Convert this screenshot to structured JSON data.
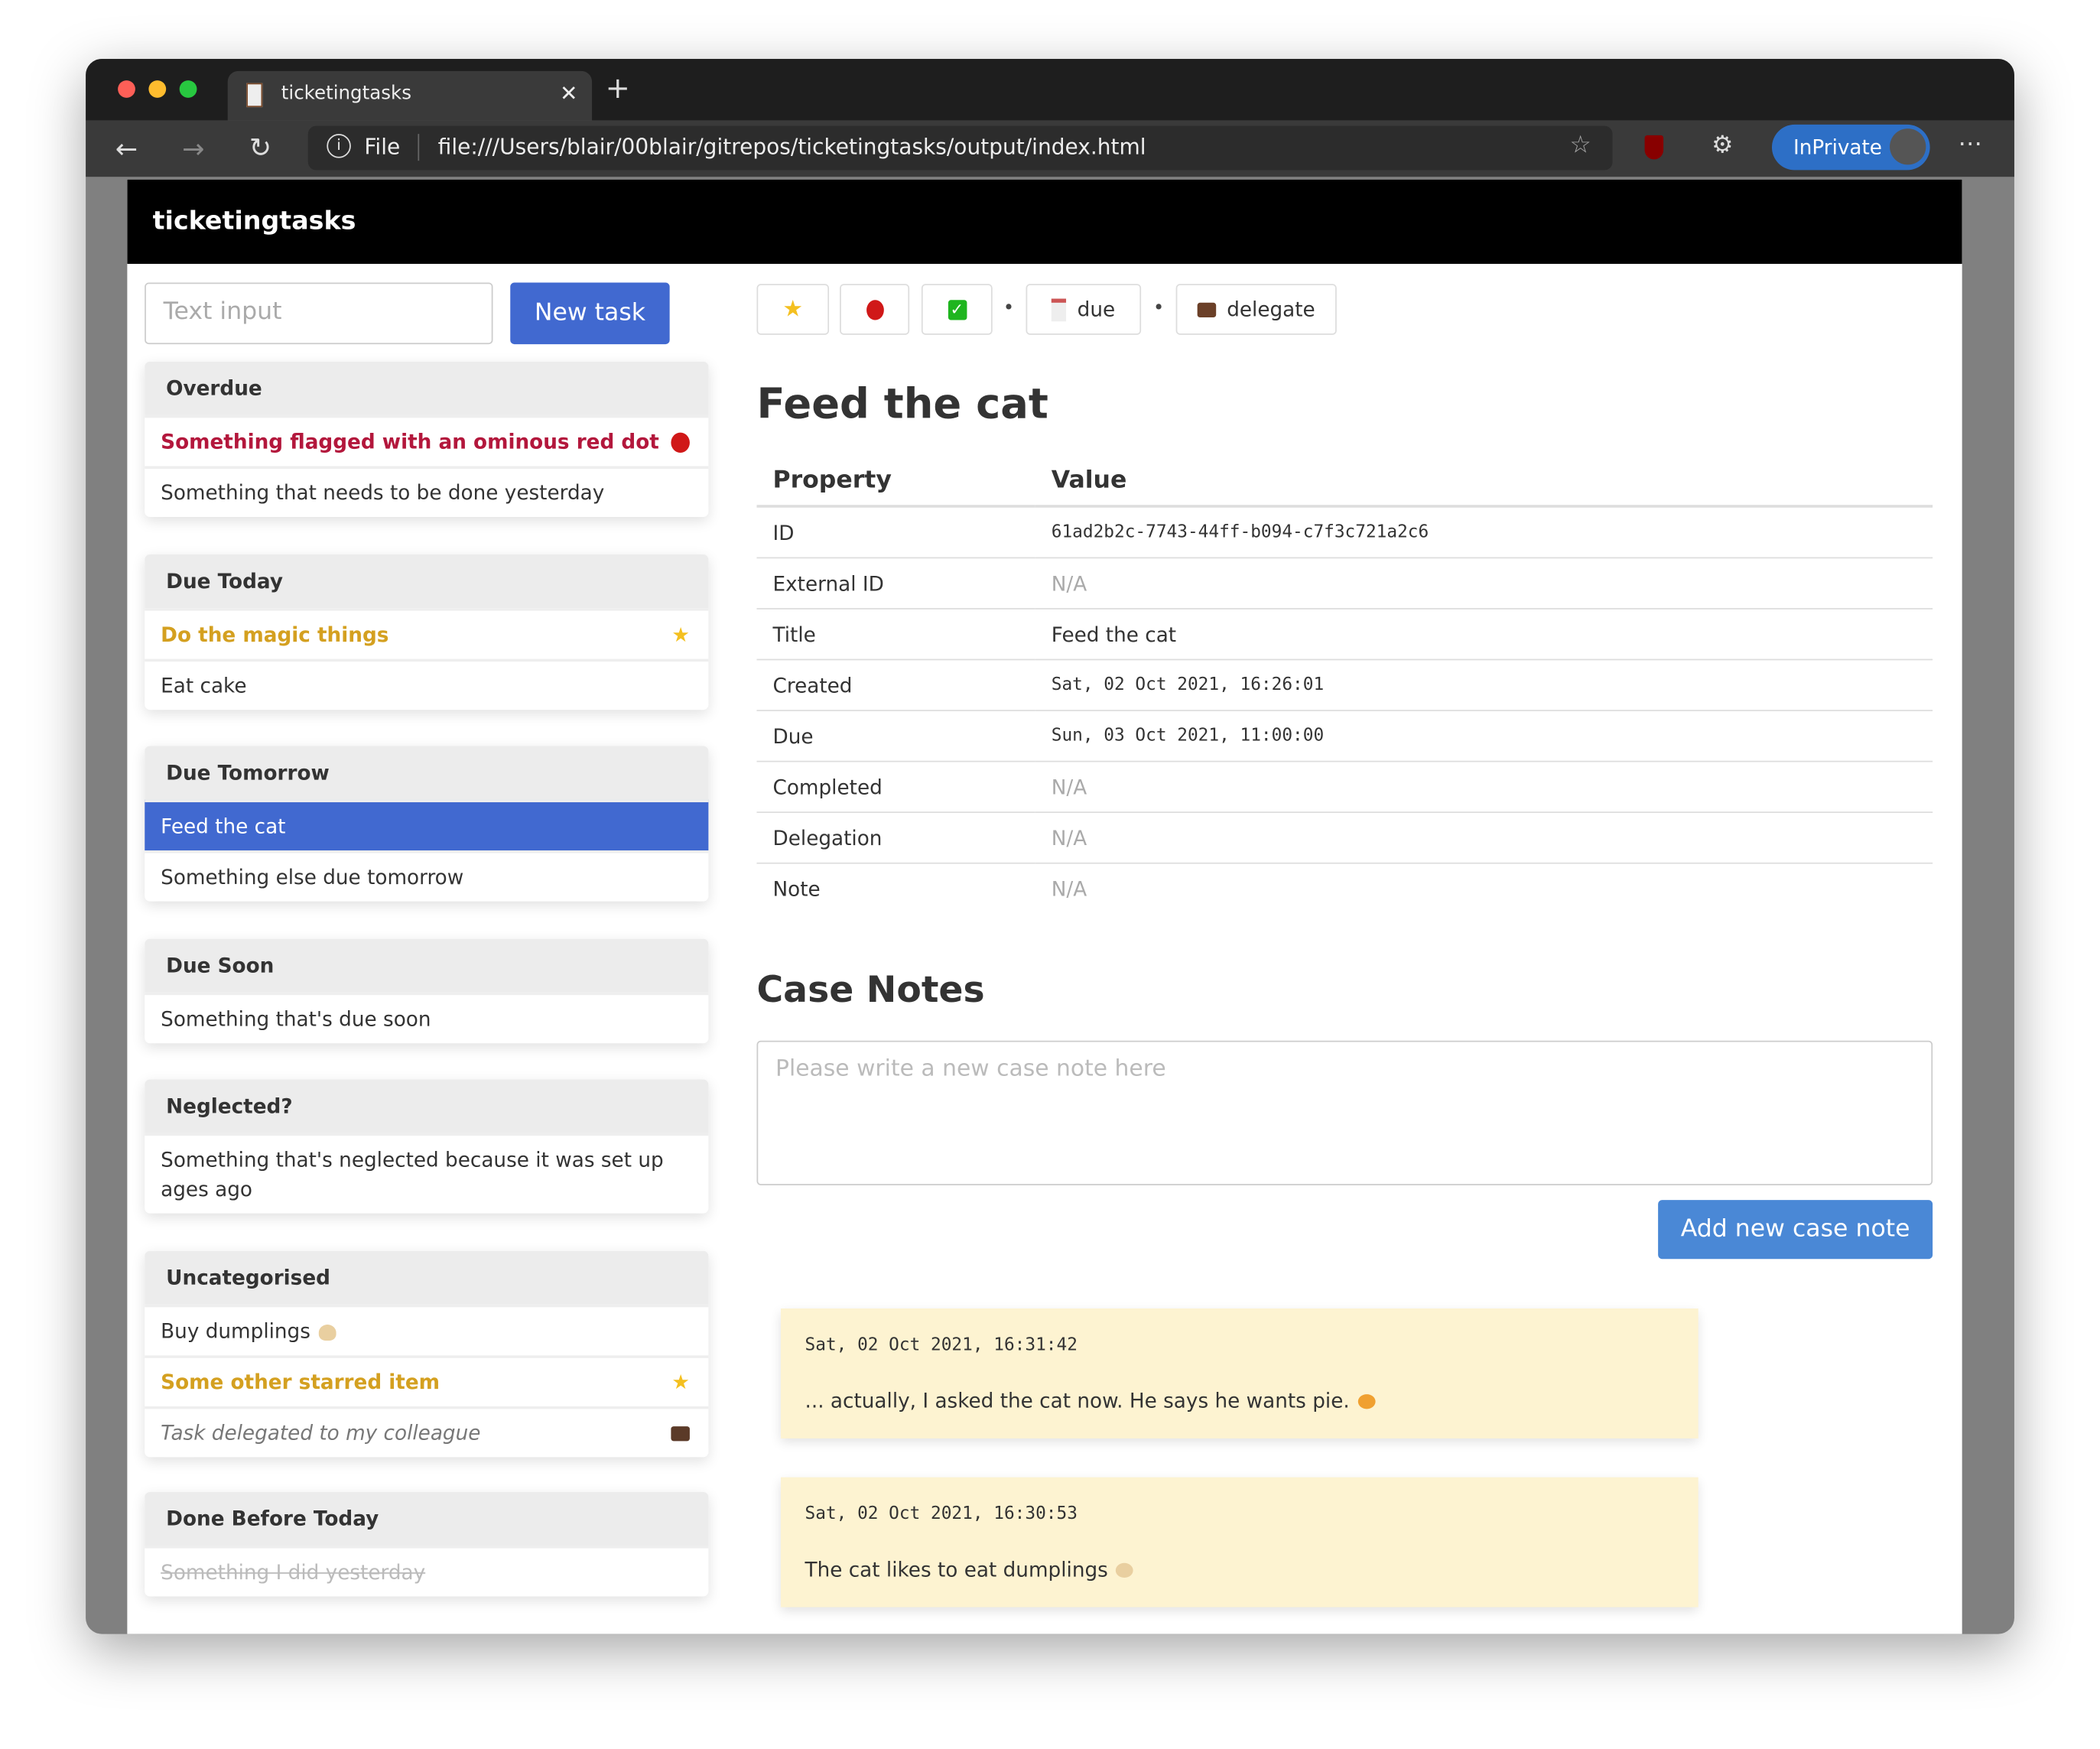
{
  "browser": {
    "tab_title": "ticketingtasks",
    "url_scheme_label": "File",
    "url": "file:///Users/blair/00blair/gitrepos/ticketingtasks/output/index.html",
    "inprivate_label": "InPrivate",
    "accent": "#2d6fc6"
  },
  "app": {
    "title": "ticketingtasks"
  },
  "sidebar": {
    "input_placeholder": "Text input",
    "new_task_label": "New task",
    "groups": [
      {
        "title": "Overdue",
        "items": [
          {
            "label": "Something flagged with an ominous red dot",
            "style": "flagged",
            "icon": "red-dot-icon"
          },
          {
            "label": "Something that needs to be done yesterday"
          }
        ]
      },
      {
        "title": "Due Today",
        "items": [
          {
            "label": "Do the magic things",
            "style": "starred",
            "icon": "star-icon"
          },
          {
            "label": "Eat cake"
          }
        ]
      },
      {
        "title": "Due Tomorrow",
        "items": [
          {
            "label": "Feed the cat",
            "style": "selected"
          },
          {
            "label": "Something else due tomorrow"
          }
        ]
      },
      {
        "title": "Due Soon",
        "items": [
          {
            "label": "Something that's due soon"
          }
        ]
      },
      {
        "title": "Neglected?",
        "items": [
          {
            "label": "Something that's neglected because it was set up ages ago"
          }
        ]
      },
      {
        "title": "Uncategorised",
        "items": [
          {
            "label": "Buy dumplings",
            "icon": "dumpling-icon"
          },
          {
            "label": "Some other starred item",
            "style": "starred",
            "icon": "star-icon"
          },
          {
            "label": "Task delegated to my colleague",
            "style": "delegated",
            "icon": "briefcase-icon"
          }
        ]
      },
      {
        "title": "Done Before Today",
        "items": [
          {
            "label": "Something I did yesterday",
            "style": "done"
          }
        ]
      }
    ]
  },
  "detail": {
    "toolbar": {
      "due_label": "due",
      "delegate_label": "delegate",
      "separator": "•"
    },
    "title": "Feed the cat",
    "table": {
      "headers": [
        "Property",
        "Value"
      ],
      "rows": [
        {
          "property": "ID",
          "value": "61ad2b2c-7743-44ff-b094-c7f3c721a2c6"
        },
        {
          "property": "External ID",
          "value": "N/A"
        },
        {
          "property": "Title",
          "value": "Feed the cat"
        },
        {
          "property": "Created",
          "value": "Sat, 02 Oct 2021, 16:26:01"
        },
        {
          "property": "Due",
          "value": "Sun, 03 Oct 2021, 11:00:00"
        },
        {
          "property": "Completed",
          "value": "N/A"
        },
        {
          "property": "Delegation",
          "value": "N/A"
        },
        {
          "property": "Note",
          "value": "N/A"
        }
      ]
    },
    "case_notes_heading": "Case Notes",
    "note_placeholder": "Please write a new case note here",
    "add_note_label": "Add new case note",
    "notes": [
      {
        "timestamp": "Sat, 02 Oct 2021, 16:31:42",
        "text": "... actually, I asked the cat now. He says he wants pie.",
        "icon": "pie-icon"
      },
      {
        "timestamp": "Sat, 02 Oct 2021, 16:30:53",
        "text": "The cat likes to eat dumplings",
        "icon": "dumpling-icon"
      }
    ]
  }
}
